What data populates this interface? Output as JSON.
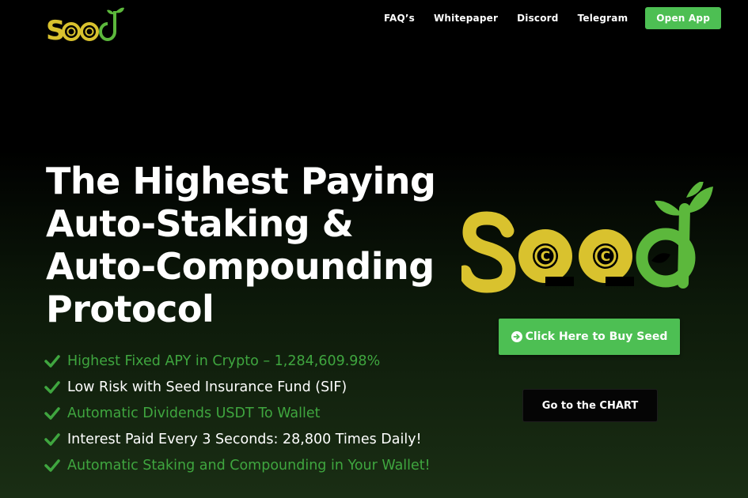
{
  "brand": {
    "name": "Seed",
    "logo_letters": "Seed"
  },
  "nav": {
    "items": [
      {
        "label": "FAQ’s"
      },
      {
        "label": "Whitepaper"
      },
      {
        "label": "Discord"
      },
      {
        "label": "Telegram"
      }
    ],
    "open_app_label": "Open App"
  },
  "hero": {
    "title_lines": [
      "The Highest Paying",
      "Auto-Staking &",
      "Auto-Compounding",
      "Protocol"
    ],
    "features": [
      {
        "text": "Highest Fixed APY in Crypto – 1,284,609.98%",
        "style": "green"
      },
      {
        "text": "Low Risk with Seed Insurance Fund (SIF)",
        "style": "white"
      },
      {
        "text": "Automatic Dividends USDT To Wallet",
        "style": "green"
      },
      {
        "text": "Interest Paid Every 3 Seconds: 28,800 Times Daily!",
        "style": "white"
      },
      {
        "text": "Automatic Staking and Compounding in Your Wallet!",
        "style": "green"
      }
    ]
  },
  "cta": {
    "buy_label": "Click Here to Buy Seed",
    "chart_label": "Go to the CHART"
  },
  "colors": {
    "accent_green": "#4dbf53",
    "feature_green": "#3fa63f",
    "logo_yellow": "#d9c22e",
    "logo_green": "#5cb83c"
  },
  "icons": {
    "check": "check-icon",
    "buy_arrow": "arrow-circle-right-icon",
    "coin": "crypto-coin-icon",
    "sprout": "sprout-leaf-icon"
  }
}
